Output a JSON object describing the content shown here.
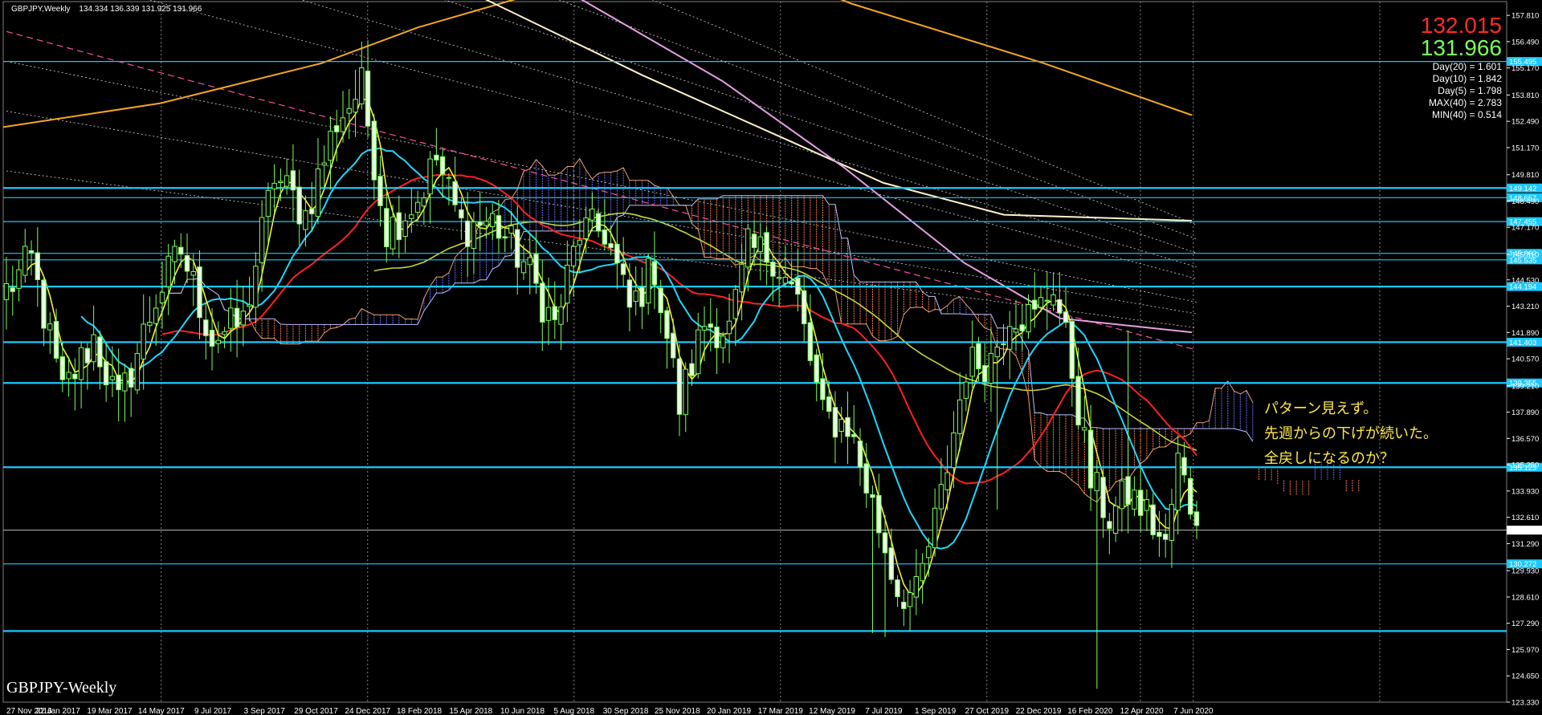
{
  "header": {
    "symbol": "GBPJPY,Weekly",
    "ohlc": "134.334 136.339 131.925 131.966"
  },
  "prices": {
    "ask": "132.015",
    "bid": "131.966"
  },
  "stats": [
    "Day(20) = 1.601",
    "Day(10) = 1.842",
    "Day(5) = 1.798",
    "MAX(40) = 2.783",
    "MIN(40) = 0.514"
  ],
  "symbol_label": "GBPJPY-Weekly",
  "notes": [
    "パターン見えず。",
    "先週からの下げが続いた。",
    "全戻しになるのか？"
  ],
  "colors": {
    "background": "#000000",
    "candle": "#7cff5a",
    "candle_body_up": "#000000",
    "candle_body_down": "#e8ffe0",
    "hline": "#19c8ff",
    "ma_fast": "#ffef3a",
    "ma_mid": "#1ed8ff",
    "ma_slow": "#ff2020",
    "ma_long_yellow": "#c8d43a",
    "ma_orange": "#f5a623",
    "ma_white": "#fff2c8",
    "ma_violet": "#e6a0e6",
    "cloud_bear": "#ff7a50",
    "cloud_bull": "#6a6aff",
    "note": "#ffe94d"
  },
  "chart_data": {
    "type": "candlestick",
    "title": "GBPJPY,Weekly",
    "ylim": [
      123.33,
      158.5
    ],
    "y_ticks": [
      "157.810",
      "156.490",
      "155.170",
      "153.810",
      "152.490",
      "151.170",
      "149.810",
      "148.490",
      "147.170",
      "145.810",
      "144.530",
      "143.210",
      "141.890",
      "140.570",
      "139.210",
      "137.890",
      "136.570",
      "135.250",
      "133.930",
      "132.610",
      "131.290",
      "129.930",
      "128.610",
      "127.290",
      "125.970",
      "124.650",
      "123.330"
    ],
    "x_ticks": [
      "27 Nov 2016",
      "22 Jan 2017",
      "19 Mar 2017",
      "14 May 2017",
      "9 Jul 2017",
      "3 Sep 2017",
      "29 Oct 2017",
      "24 Dec 2017",
      "18 Feb 2018",
      "15 Apr 2018",
      "10 Jun 2018",
      "5 Aug 2018",
      "30 Sep 2018",
      "25 Nov 2018",
      "20 Jan 2019",
      "17 Mar 2019",
      "12 May 2019",
      "7 Jul 2019",
      "1 Sep 2019",
      "27 Oct 2019",
      "22 Dec 2019",
      "16 Feb 2020",
      "12 Apr 2020",
      "7 Jun 2020"
    ],
    "horizontal_levels": [
      {
        "label": "155.495",
        "value": 155.495
      },
      {
        "label": "149.142",
        "value": 149.142
      },
      {
        "label": "148.657",
        "value": 148.657
      },
      {
        "label": "147.455",
        "value": 147.455
      },
      {
        "label": "145.862",
        "value": 145.862
      },
      {
        "label": "145.535",
        "value": 145.535
      },
      {
        "label": "144.194",
        "value": 144.194
      },
      {
        "label": "141.403",
        "value": 141.403
      },
      {
        "label": "139.355",
        "value": 139.355
      },
      {
        "label": "135.123",
        "value": 135.123
      },
      {
        "label": "130.272",
        "value": 130.272
      },
      {
        "label": "126.900",
        "value": 126.9
      }
    ],
    "current_price": {
      "label": "131.966",
      "value": 131.966
    },
    "anchors": [
      [
        0,
        144.0
      ],
      [
        4,
        145.5
      ],
      [
        9,
        138.8
      ],
      [
        14,
        141.6
      ],
      [
        18,
        138.2
      ],
      [
        24,
        143.6
      ],
      [
        28,
        146.0
      ],
      [
        33,
        141.6
      ],
      [
        38,
        142.4
      ],
      [
        43,
        149.8
      ],
      [
        48,
        147.8
      ],
      [
        53,
        152.5
      ],
      [
        57,
        154.2
      ],
      [
        61,
        147.0
      ],
      [
        66,
        148.6
      ],
      [
        69,
        150.6
      ],
      [
        73,
        147.2
      ],
      [
        78,
        147.5
      ],
      [
        83,
        145.4
      ],
      [
        88,
        142.2
      ],
      [
        92,
        147.0
      ],
      [
        96,
        147.0
      ],
      [
        100,
        143.0
      ],
      [
        104,
        145.2
      ],
      [
        108,
        138.2
      ],
      [
        112,
        142.4
      ],
      [
        116,
        142.0
      ],
      [
        119,
        146.0
      ],
      [
        123,
        145.8
      ],
      [
        127,
        143.4
      ],
      [
        131,
        137.6
      ],
      [
        135,
        137.3
      ],
      [
        139,
        133.2
      ],
      [
        143,
        129.0
      ],
      [
        146,
        128.6
      ],
      [
        150,
        133.6
      ],
      [
        154,
        140.2
      ],
      [
        158,
        140.6
      ],
      [
        161,
        143.0
      ],
      [
        165,
        142.6
      ],
      [
        168,
        144.4
      ],
      [
        171,
        140.0
      ],
      [
        174,
        134.4
      ],
      [
        177,
        132.6
      ],
      [
        180,
        133.8
      ],
      [
        183,
        132.8
      ],
      [
        186,
        131.0
      ],
      [
        188,
        135.4
      ],
      [
        191,
        132.2
      ]
    ]
  }
}
